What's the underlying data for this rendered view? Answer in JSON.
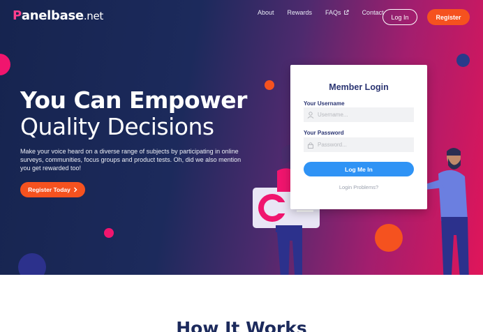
{
  "brand": {
    "name_first": "P",
    "name_rest": "anelbase",
    "tld": ".net"
  },
  "nav": {
    "links": [
      "About",
      "Rewards",
      "FAQs",
      "Contact"
    ],
    "login_label": "Log In",
    "register_label": "Register"
  },
  "hero": {
    "headline_line1": "You Can Empower",
    "headline_line2": "Quality Decisions",
    "intro": "Make your voice heard on a diverse range of subjects by participating in online surveys, communities, focus groups and product tests. Oh, did we also mention you get rewarded too!",
    "cta_label": "Register Today"
  },
  "login_card": {
    "title": "Member Login",
    "username_label": "Your Username",
    "username_placeholder": "Username...",
    "username_value": "",
    "password_label": "Your Password",
    "password_placeholder": "Password...",
    "password_value": "",
    "submit_label": "Log Me In",
    "problems_link": "Login Problems?"
  },
  "section": {
    "title": "How It Works"
  },
  "icons": {
    "faqs_link": "external-link-icon",
    "cta": "chevron-right-icon",
    "username": "user-icon",
    "password": "lock-icon"
  },
  "colors": {
    "navy": "#1c2a5c",
    "magenta": "#e0155a",
    "orange": "#f5521f",
    "button_blue": "#2f93f5",
    "pink_accent": "#ff3f8e"
  }
}
